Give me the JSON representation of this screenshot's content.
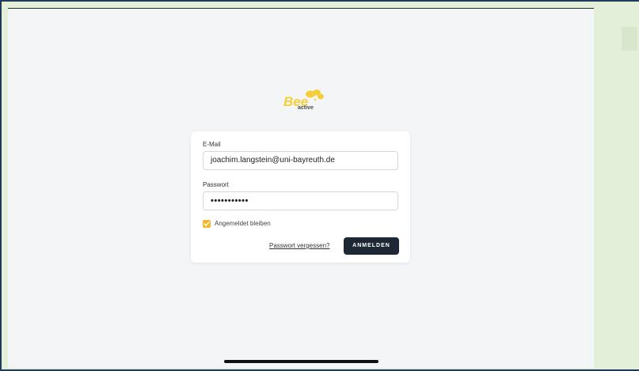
{
  "app": {
    "logo_text": "Bee active"
  },
  "login_form": {
    "email_label": "E-Mail",
    "email_value": "joachim.langstein@uni-bayreuth.de",
    "password_label": "Passwort",
    "password_value": "•••••••••••",
    "remember_label": "Angemeldet bleiben",
    "remember_checked": true,
    "forgot_link": "Passwort vergessen?",
    "submit_label": "ANMELDEN"
  },
  "colors": {
    "accent": "#f2b82f",
    "button": "#1e2734",
    "background": "#f4f5f7",
    "outer": "#e3efd9"
  }
}
